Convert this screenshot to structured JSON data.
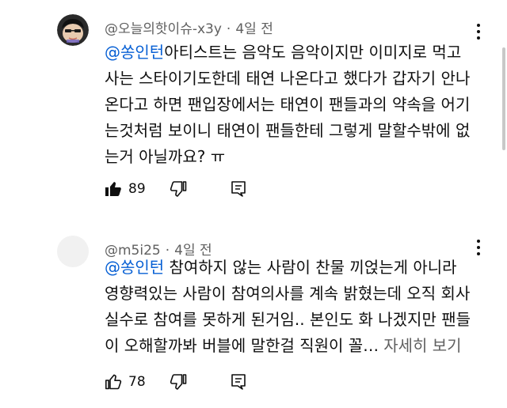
{
  "comments": [
    {
      "username": "@오늘의핫이슈-x3y",
      "time": "4일 전",
      "mention": "@쏭인턴",
      "lines": [
        "아티스트는 음악도 음악이지만 이미지로 먹고",
        "사는 스타이기도한데 태연 나온다고 했다가 갑자기 안나",
        "온다고 하면 팬입장에서는 태연이 팬들과의 약속을 어기",
        "는것처럼 보이니 태연이 팬들한테 그렇게 말할수밖에 없",
        "는거 아닐까요? ㅠ"
      ],
      "like_count": "89",
      "avatar_icon": "user-avatar-icon",
      "liked": true
    },
    {
      "username": "@m5i25",
      "time": "4일 전",
      "mention": "@쏭인턴",
      "lines": [
        " 참여하지 않는 사람이 찬물 끼얹는게 아니라",
        "영향력있는 사람이 참여의사를 계속 밝혔는데 오직 회사",
        "실수로 참여를 못하게 된거임.. 본인도 화 나겠지만 팬들",
        "이 오해할까봐 버블에 말한걸 직원이 꼴…"
      ],
      "more_label": "자세히 보기",
      "like_count": "78",
      "avatar_icon": "default-avatar-icon",
      "liked": false
    }
  ],
  "icons": {
    "like": "thumbs-up-icon",
    "dislike": "thumbs-down-icon",
    "reply": "reply-icon",
    "menu": "more-vertical-icon"
  },
  "colors": {
    "mention": "#065fd4",
    "meta": "#606060",
    "text": "#0f0f0f"
  }
}
